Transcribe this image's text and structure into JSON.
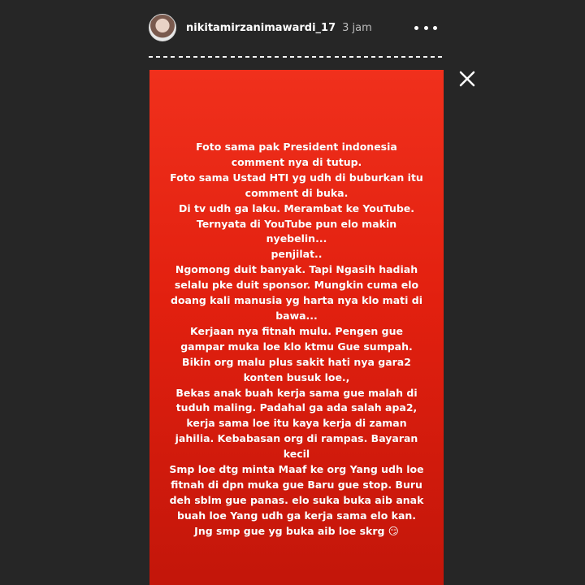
{
  "header": {
    "username": "nikitamirzanimawardi_17",
    "time": "3 jam",
    "more_icon": "more-horizontal-icon"
  },
  "close_icon": "close-icon",
  "story": {
    "background_color": "#e2200f",
    "lines": [
      "Foto sama  pak President indonesia",
      "comment nya di tutup.",
      "Foto sama Ustad HTI yg udh di buburkan itu",
      "comment di buka.",
      "Di tv udh ga laku. Merambat ke YouTube.",
      "Ternyata di YouTube pun elo makin",
      "nyebelin...",
      "penjilat..",
      "Ngomong duit banyak. Tapi Ngasih hadiah",
      "selalu pke duit sponsor. Mungkin cuma elo",
      "doang kali manusia yg harta nya klo mati di",
      "bawa...",
      "Kerjaan nya fitnah mulu. Pengen gue",
      "gampar muka loe klo ktmu Gue sumpah.",
      "Bikin org malu plus sakit hati nya gara2",
      "konten busuk loe.,",
      "Bekas anak buah kerja sama gue malah di",
      "tuduh maling. Padahal ga ada salah apa2,",
      "kerja sama loe itu kaya kerja di zaman",
      "jahilia. Kebabasan org di rampas. Bayaran",
      "kecil",
      "Smp loe dtg minta Maaf ke org Yang udh loe",
      "fitnah di dpn muka gue Baru gue stop. Buru",
      "deh sblm gue panas. elo suka buka aib anak",
      "buah loe Yang udh ga kerja sama elo kan.",
      "Jng smp gue yg buka aib loe skrg 😏"
    ]
  }
}
